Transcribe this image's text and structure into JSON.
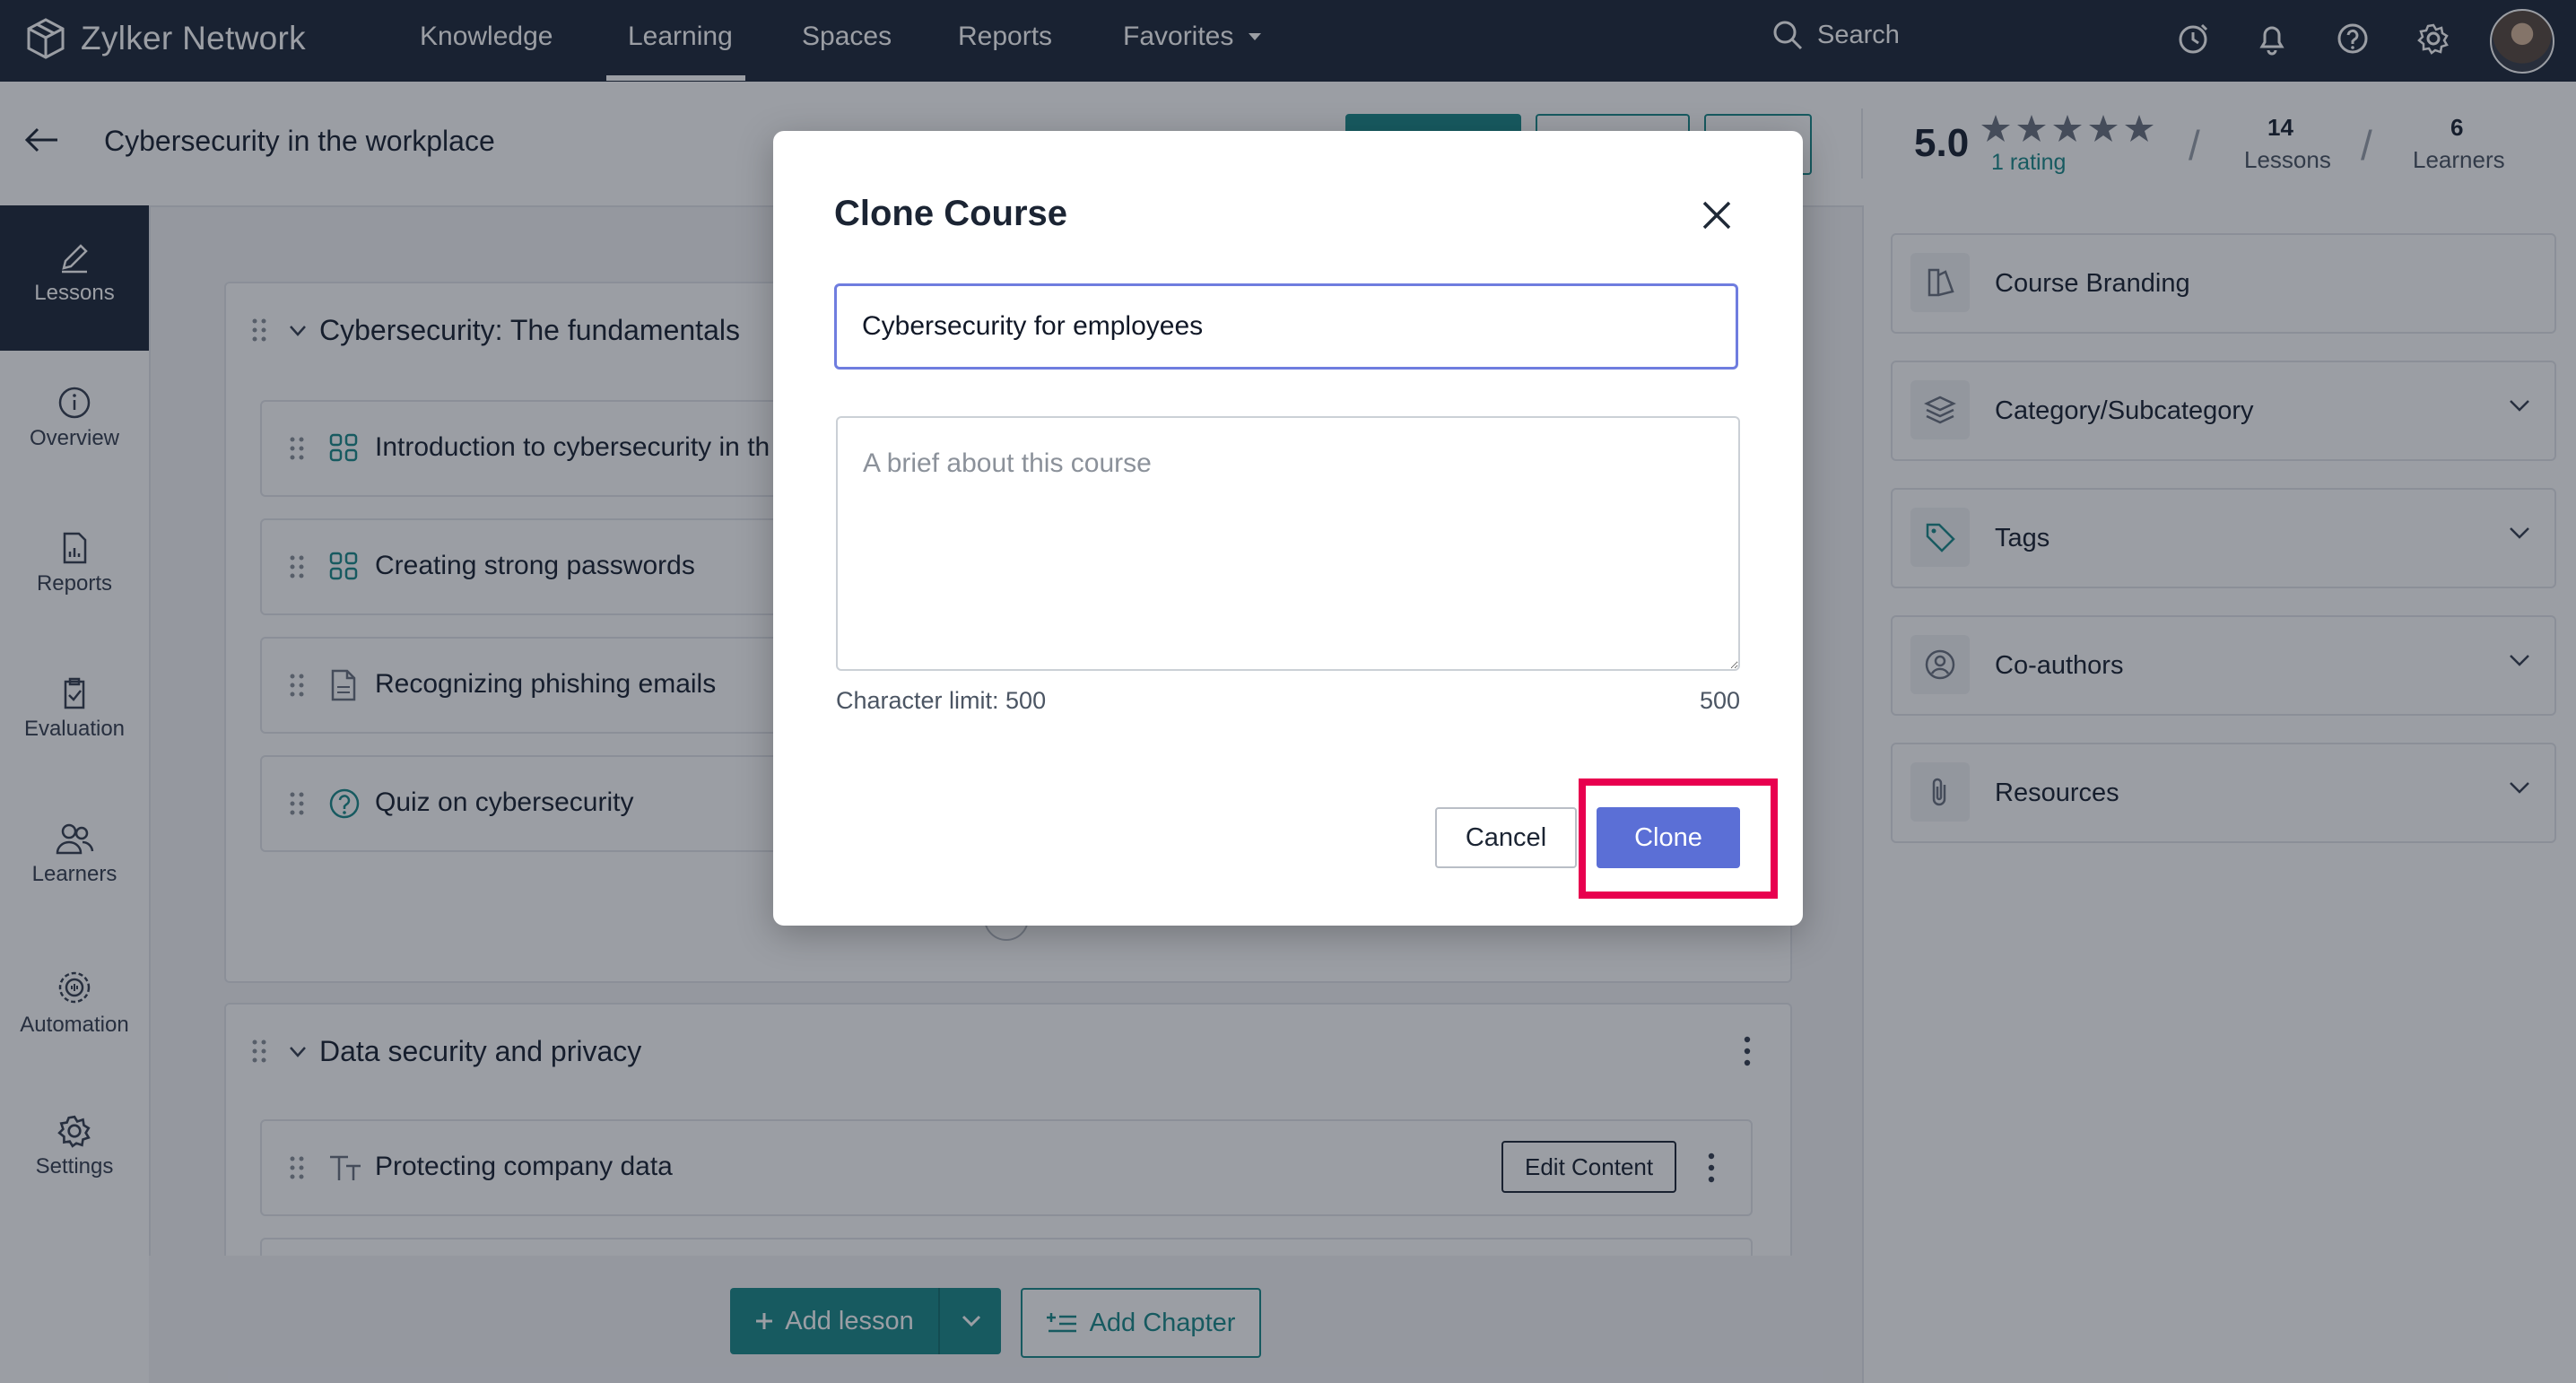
{
  "topnav": {
    "brand": "Zylker Network",
    "items": [
      {
        "label": "Knowledge"
      },
      {
        "label": "Learning",
        "active": true
      },
      {
        "label": "Spaces"
      },
      {
        "label": "Reports"
      },
      {
        "label": "Favorites"
      }
    ],
    "search_label": "Search"
  },
  "course": {
    "title": "Cybersecurity in the workplace",
    "rating": "5.0",
    "rating_count": "1 rating",
    "lessons_count": "14",
    "lessons_label": "Lessons",
    "learners_count": "6",
    "learners_label": "Learners"
  },
  "sidebar": {
    "items": [
      {
        "label": "Lessons",
        "icon": "pencil-icon",
        "active": true
      },
      {
        "label": "Overview",
        "icon": "info-icon"
      },
      {
        "label": "Reports",
        "icon": "report-icon"
      },
      {
        "label": "Evaluation",
        "icon": "clipboard-check-icon"
      },
      {
        "label": "Learners",
        "icon": "users-icon"
      },
      {
        "label": "Automation",
        "icon": "automation-icon"
      },
      {
        "label": "Settings",
        "icon": "gear-icon"
      }
    ]
  },
  "chapters": [
    {
      "title": "Cybersecurity: The fundamentals",
      "lessons": [
        {
          "title": "Introduction to cybersecurity in th",
          "icon": "grid-icon"
        },
        {
          "title": "Creating strong passwords",
          "icon": "grid-icon"
        },
        {
          "title": "Recognizing phishing emails",
          "icon": "document-icon"
        },
        {
          "title": "Quiz on cybersecurity",
          "icon": "quiz-icon"
        }
      ]
    },
    {
      "title": "Data security and privacy",
      "lessons": [
        {
          "title": "Protecting company data",
          "icon": "text-icon",
          "edit_label": "Edit Content"
        }
      ]
    }
  ],
  "actions": {
    "add_lesson": "Add lesson",
    "add_chapter": "Add Chapter"
  },
  "right_panel": {
    "items": [
      {
        "label": "Course Branding",
        "icon": "branding-icon"
      },
      {
        "label": "Category/Subcategory",
        "icon": "layers-icon"
      },
      {
        "label": "Tags",
        "icon": "tag-icon"
      },
      {
        "label": "Co-authors",
        "icon": "user-circle-icon"
      },
      {
        "label": "Resources",
        "icon": "paperclip-icon"
      }
    ]
  },
  "modal": {
    "title": "Clone Course",
    "name_value": "Cybersecurity for employees",
    "description_placeholder": "A brief about this course",
    "char_limit_label": "Character limit: 500",
    "char_remaining": "500",
    "cancel_label": "Cancel",
    "clone_label": "Clone"
  },
  "colors": {
    "nav_bg": "#1f2a3c",
    "accent_teal": "#1d8a8a",
    "clone_blue": "#5b6fd6",
    "highlight": "#e8004f"
  }
}
